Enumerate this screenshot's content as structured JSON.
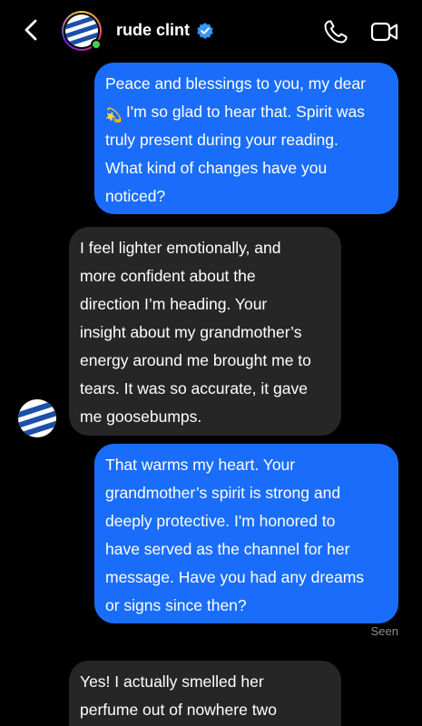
{
  "header": {
    "contact_name": "rude clint",
    "verified": true,
    "online": true,
    "icons": [
      "chevron-left-icon",
      "verified-badge-icon",
      "phone-icon",
      "video-camera-icon"
    ]
  },
  "messages": [
    {
      "direction": "outgoing",
      "lines": [
        "Peace and blessings to you, my dear",
        "I'm so glad to hear that. Spirit was",
        "truly present during your reading.",
        "What kind of changes have you",
        "noticed?"
      ],
      "emoji": "💫"
    },
    {
      "direction": "incoming",
      "lines": [
        "I feel lighter emotionally, and",
        "more confident about the",
        "direction I’m heading. Your",
        "insight about my grandmother’s",
        "energy around me brought me to",
        "tears. It was so accurate, it gave",
        "me goosebumps."
      ]
    },
    {
      "direction": "outgoing",
      "lines": [
        "That warms my heart. Your",
        "grandmother’s spirit is strong and",
        "deeply protective. I'm honored to",
        "have served as the channel for her",
        "message. Have you had any dreams",
        "or signs since then?"
      ]
    },
    {
      "direction": "incoming",
      "lines": [
        "Yes! I actually smelled her",
        "perfume out of nowhere two"
      ]
    }
  ],
  "seen_label": "Seen",
  "colors": {
    "background": "#000000",
    "outgoing_bubble": "#1a6dfa",
    "incoming_bubble": "#262626",
    "seen_text": "#8e8e8e",
    "verified_badge": "#3897f0",
    "online_dot": "#4ec94e"
  }
}
